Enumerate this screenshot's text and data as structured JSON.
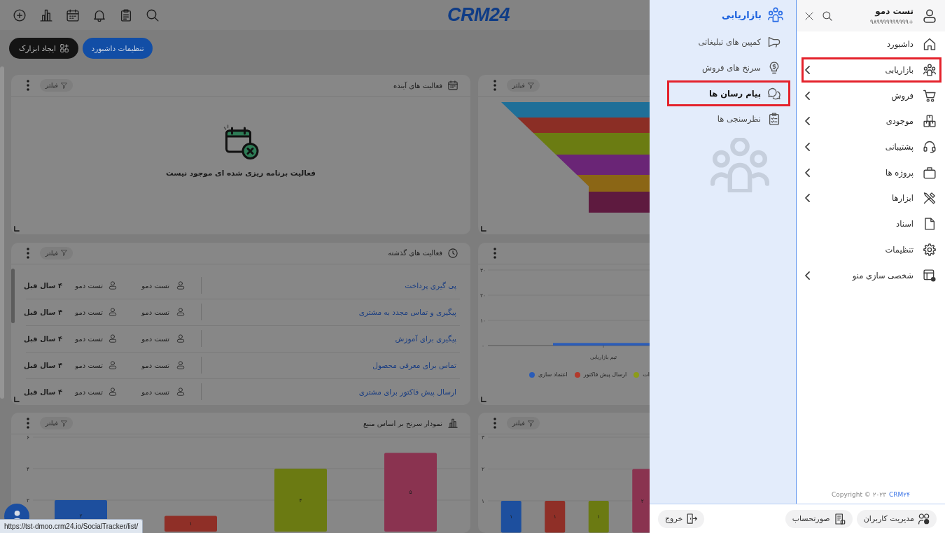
{
  "sidebar": {
    "user": {
      "name": "تست دمو",
      "phone": "۹۸۹۹۹۹۹۹۹۹۹۹+"
    },
    "items": [
      {
        "label": "داشبورد",
        "expandable": false,
        "highlighted": false
      },
      {
        "label": "بازاریابی",
        "expandable": true,
        "highlighted": true
      },
      {
        "label": "فروش",
        "expandable": true,
        "highlighted": false
      },
      {
        "label": "موجودی",
        "expandable": true,
        "highlighted": false
      },
      {
        "label": "پشتیبانی",
        "expandable": true,
        "highlighted": false
      },
      {
        "label": "پروژه ها",
        "expandable": true,
        "highlighted": false
      },
      {
        "label": "ابزارها",
        "expandable": true,
        "highlighted": false
      },
      {
        "label": "اسناد",
        "expandable": false,
        "highlighted": false
      },
      {
        "label": "تنظیمات",
        "expandable": false,
        "highlighted": false
      },
      {
        "label": "شخصی سازی منو",
        "expandable": true,
        "highlighted": false
      }
    ],
    "copyright": "Copyright © ۲۰۲۳",
    "copyright_link": "CRM۲۴"
  },
  "submenu": {
    "title": "بازاریابی",
    "items": [
      {
        "label": "کمپین های تبلیغاتی",
        "selected": false,
        "highlighted": false
      },
      {
        "label": "سرنخ های فروش",
        "selected": false,
        "highlighted": false
      },
      {
        "label": "پیام رسان ها",
        "selected": true,
        "highlighted": true
      },
      {
        "label": "نظرسنجی ها",
        "selected": false,
        "highlighted": false
      }
    ]
  },
  "footer": {
    "buttons": [
      "مدیریت کاربران",
      "صورتحساب"
    ],
    "logout": "خروج"
  },
  "topbar": {
    "logo": "CRM24"
  },
  "dashboard_buttons": [
    {
      "label": "تنظیمات داشبورد",
      "kind": "primary"
    },
    {
      "label": "ایجاد ابزارک",
      "kind": "dark"
    }
  ],
  "widgets": [
    {
      "kind": "funnel",
      "filter": "فیلتر"
    },
    {
      "kind": "empty",
      "title": "فعالیت های آینده",
      "filter": "فیلتر",
      "message": "فعالیت برنامه ریزی شده ای موجود نیست"
    },
    {
      "kind": "bar_chart",
      "chart_data": {
        "type": "bar",
        "stacked": true,
        "categories": [
          "تیم بازاریابی"
        ],
        "ylim": [
          0,
          30
        ],
        "yticks": [
          {
            "value": 0,
            "label": "۰"
          },
          {
            "value": 10,
            "label": "۱۰"
          },
          {
            "value": 20,
            "label": "۲۰"
          },
          {
            "value": 30,
            "label": "۳۰"
          }
        ],
        "series": [
          {
            "name": "اعتماد سازی",
            "color": "#2a5cb8",
            "values": [
              1
            ]
          },
          {
            "name": "ارسال پیش فاکتور",
            "color": "#b23a2c",
            "values": [
              0
            ]
          },
          {
            "name": "ات",
            "color": "#8c9c18",
            "values": [
              0
            ]
          }
        ]
      }
    },
    {
      "kind": "activity_list",
      "title": "فعالیت های گذشته",
      "filter": "فیلتر",
      "rows": [
        {
          "title": "پی گیری پرداخت",
          "user_1": "تست دمو",
          "user_2": "تست دمو",
          "time": "۴ سال قبل"
        },
        {
          "title": "پیگیری و تماس مجدد به مشتری",
          "user_1": "تست دمو",
          "user_2": "تست دمو",
          "time": "۴ سال قبل"
        },
        {
          "title": "پیگیری برای آموزش",
          "user_1": "تست دمو",
          "user_2": "تست دمو",
          "time": "۴ سال قبل"
        },
        {
          "title": "تماس برای معرفی محصول",
          "user_1": "تست دمو",
          "user_2": "تست دمو",
          "time": "۴ سال قبل"
        },
        {
          "title": "ارسال پیش فاکتور برای مشتری",
          "user_1": "تست دمو",
          "user_2": "تست دمو",
          "time": "۴ سال قبل"
        }
      ]
    },
    {
      "kind": "bar_chart",
      "filter": "فیلتر",
      "chart_data": {
        "type": "bar",
        "ylim": [
          0,
          3
        ],
        "yticks": [
          {
            "value": 1,
            "label": "۱"
          },
          {
            "value": 2,
            "label": "۲"
          },
          {
            "value": 3,
            "label": "۳"
          }
        ],
        "values": [
          1,
          1,
          1,
          2
        ],
        "colors": [
          "#1d4f9e",
          "#8f2f27",
          "#6b7a12",
          "#8a3350"
        ],
        "value_labels": [
          "۱",
          "۱",
          "۱",
          "۲"
        ]
      }
    },
    {
      "kind": "bar_chart",
      "title": "نمودار سرنخ بر اساس منبع",
      "filter": "فیلتر",
      "chart_data": {
        "type": "bar",
        "ylim": [
          0,
          6
        ],
        "yticks": [
          {
            "value": 2,
            "label": "۲"
          },
          {
            "value": 4,
            "label": "۴"
          },
          {
            "value": 6,
            "label": "۶"
          }
        ],
        "values": [
          2,
          1,
          4,
          5
        ],
        "colors": [
          "#1d4f9e",
          "#8f2f27",
          "#6b7a12",
          "#8a3350"
        ],
        "value_labels": [
          "۲",
          "۱",
          "۴",
          "۵"
        ]
      }
    }
  ],
  "status_url": "https://tst-dmoo.crm24.io/SocialTracker/list/"
}
